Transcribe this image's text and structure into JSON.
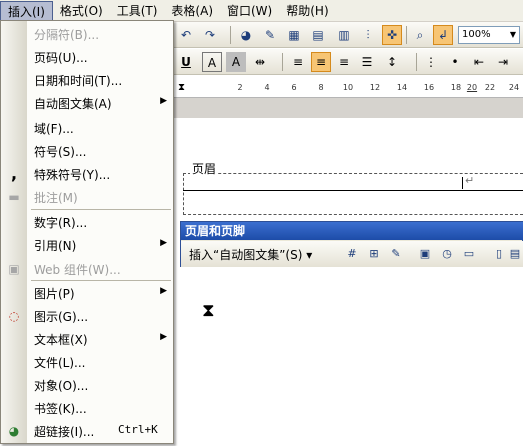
{
  "menubar": {
    "items": [
      {
        "label": "插入(I)"
      },
      {
        "label": "格式(O)"
      },
      {
        "label": "工具(T)"
      },
      {
        "label": "表格(A)"
      },
      {
        "label": "窗口(W)"
      },
      {
        "label": "帮助(H)"
      }
    ]
  },
  "toolbar": {
    "zoom_value": "100%"
  },
  "ruler": {
    "ticks": [
      "2",
      "4",
      "6",
      "8",
      "10",
      "12",
      "14",
      "16",
      "18",
      "20",
      "22",
      "24"
    ]
  },
  "document": {
    "header_tag": "页眉",
    "para_mark": "↵"
  },
  "hf_toolbar": {
    "title": "页眉和页脚",
    "insert_autotext": "插入“自动图文集”(S) ▾"
  },
  "insert_menu": {
    "items": [
      {
        "label": "分隔符(B)...",
        "disabled": true,
        "icon": "",
        "submenu": false,
        "shortcut": ""
      },
      {
        "label": "页码(U)...",
        "disabled": false,
        "icon": "",
        "submenu": false,
        "shortcut": ""
      },
      {
        "label": "日期和时间(T)...",
        "disabled": false,
        "icon": "",
        "submenu": false,
        "shortcut": ""
      },
      {
        "label": "自动图文集(A)",
        "disabled": false,
        "icon": "",
        "submenu": true,
        "shortcut": ""
      },
      {
        "label": "域(F)...",
        "disabled": false,
        "icon": "",
        "submenu": false,
        "shortcut": ""
      },
      {
        "label": "符号(S)...",
        "disabled": false,
        "icon": "",
        "submenu": false,
        "shortcut": ""
      },
      {
        "label": "特殊符号(Y)...",
        "disabled": false,
        "icon": "comma-icon",
        "submenu": false,
        "shortcut": ""
      },
      {
        "label": "批注(M)",
        "disabled": true,
        "icon": "comment-icon",
        "submenu": false,
        "shortcut": ""
      },
      {
        "label": "数字(R)...",
        "disabled": false,
        "icon": "",
        "submenu": false,
        "shortcut": ""
      },
      {
        "label": "引用(N)",
        "disabled": false,
        "icon": "",
        "submenu": true,
        "shortcut": ""
      },
      {
        "label": "Web 组件(W)...",
        "disabled": true,
        "icon": "web-component-icon",
        "submenu": false,
        "shortcut": ""
      },
      {
        "label": "图片(P)",
        "disabled": false,
        "icon": "",
        "submenu": true,
        "shortcut": ""
      },
      {
        "label": "图示(G)...",
        "disabled": false,
        "icon": "diagram-icon",
        "submenu": false,
        "shortcut": ""
      },
      {
        "label": "文本框(X)",
        "disabled": false,
        "icon": "",
        "submenu": true,
        "shortcut": ""
      },
      {
        "label": "文件(L)...",
        "disabled": false,
        "icon": "",
        "submenu": false,
        "shortcut": ""
      },
      {
        "label": "对象(O)...",
        "disabled": false,
        "icon": "",
        "submenu": false,
        "shortcut": ""
      },
      {
        "label": "书签(K)...",
        "disabled": false,
        "icon": "",
        "submenu": false,
        "shortcut": ""
      },
      {
        "label": "超链接(I)...",
        "disabled": false,
        "icon": "hyperlink-icon",
        "submenu": false,
        "shortcut": "Ctrl+K"
      }
    ]
  },
  "colors": {
    "menubar_bg": "#f0efe6",
    "menu_highlight": "#b6bdd2",
    "hf_title_bg": "#1d4ca8",
    "active_button": "#f7c574"
  }
}
